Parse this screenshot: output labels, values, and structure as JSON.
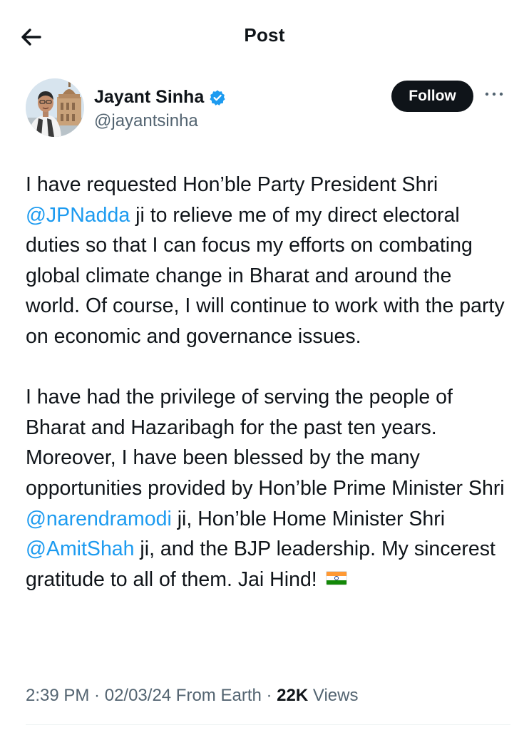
{
  "header": {
    "title": "Post",
    "back_icon": "arrow-left-icon"
  },
  "author": {
    "display_name": "Jayant Sinha",
    "handle": "@jayantsinha",
    "verified_icon": "verified-badge-icon",
    "verified_color": "#1d9bf0",
    "follow_label": "Follow",
    "more_icon": "more-horizontal-icon"
  },
  "post": {
    "p1": {
      "t1": "I have requested Hon’ble Party President Shri ",
      "m1": "@JPNadda",
      "t2": " ji to relieve me of my direct electoral duties so that I can focus my efforts on combating global climate change in Bharat and around the world. Of course, I will continue to work with the party on economic and governance issues."
    },
    "p2": {
      "t1": "I have had the privilege of serving the people of Bharat and Hazaribagh for the past ten years. Moreover, I have been blessed by the many opportunities provided by Hon’ble Prime Minister Shri ",
      "m1": "@narendramodi",
      "t2": " ji, Hon’ble Home Minister Shri ",
      "m2": "@AmitShah",
      "t3": " ji, and the BJP leadership. My sincerest gratitude to all of them. Jai Hind! ",
      "flag_icon": "india-flag-icon"
    },
    "mention_color": "#1d9bf0"
  },
  "meta": {
    "time": "2:39 PM",
    "sep1": " · ",
    "date": "02/03/24",
    "source": " From Earth",
    "sep2": " · ",
    "views_count": "22K",
    "views_label": " Views"
  }
}
